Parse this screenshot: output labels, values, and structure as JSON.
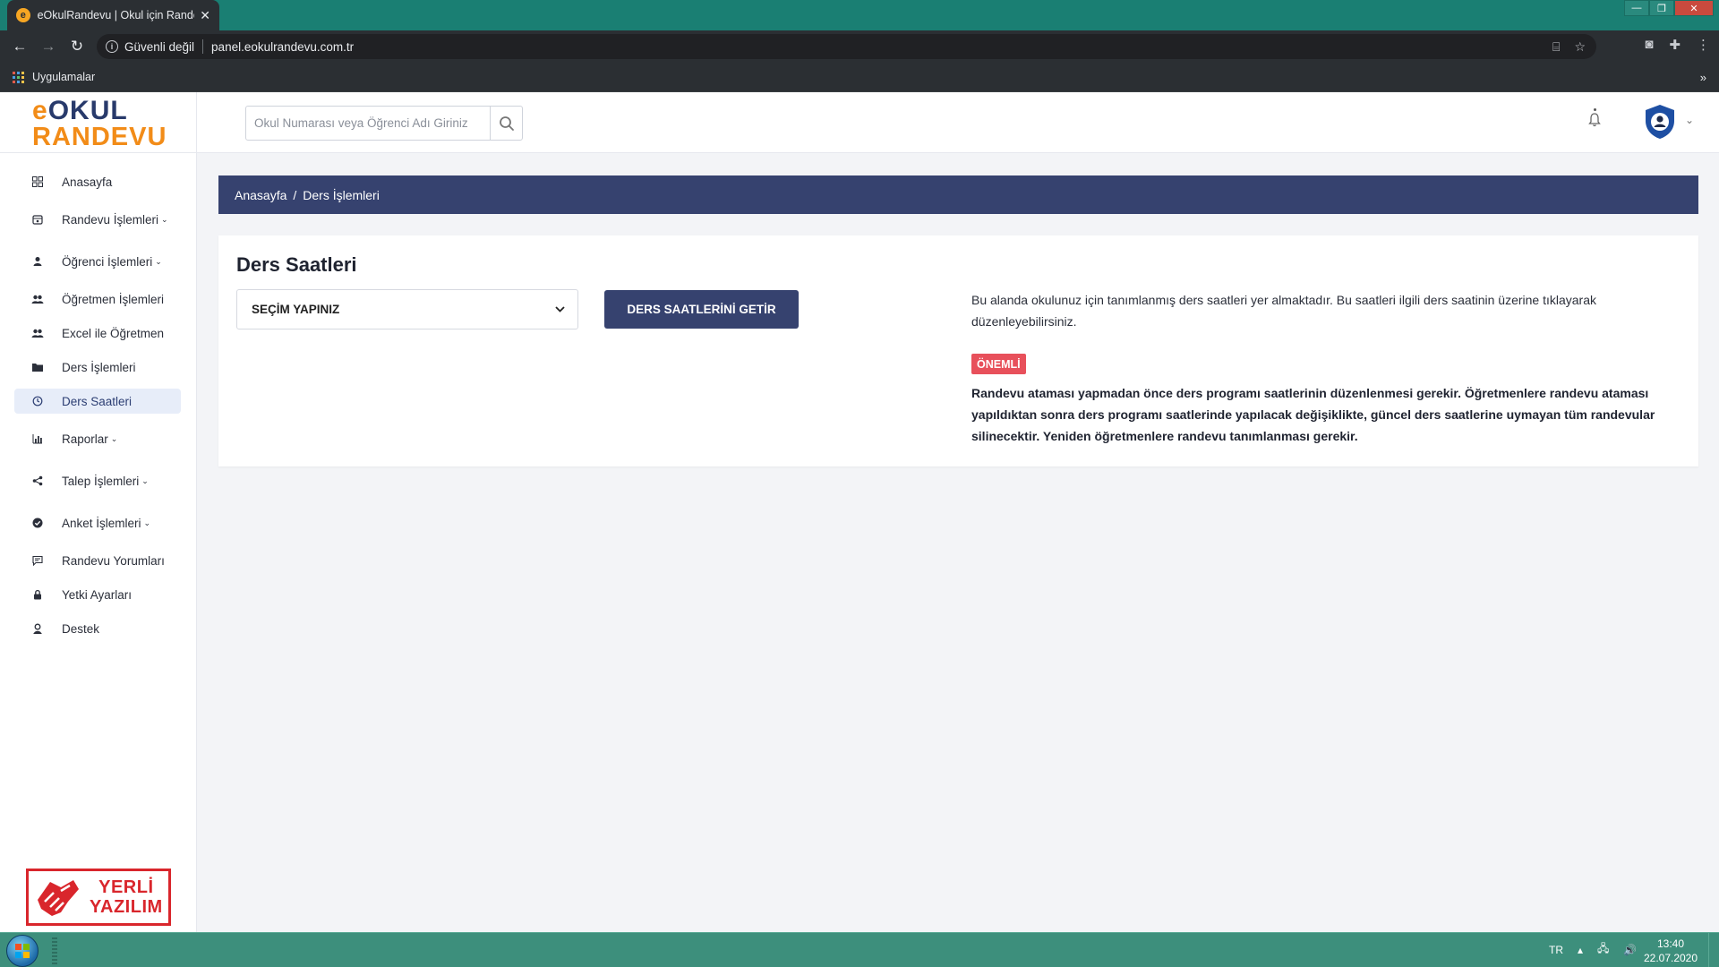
{
  "browser": {
    "tab_title": "eOkulRandevu | Okul için Randevu Sistemi",
    "tab_close": "✕",
    "security_label": "Güvenli değil",
    "url": "panel.eokulrandevu.com.tr",
    "bookmark_apps": "Uygulamalar",
    "bookmark_more": "»"
  },
  "header": {
    "logo_e": "e",
    "logo_okul": "OKUL",
    "logo_randevu": "RANDEVU",
    "search_placeholder": "Okul Numarası veya Öğrenci Adı Giriniz"
  },
  "sidebar": {
    "items": [
      {
        "label": "Anasayfa",
        "icon": "dashboard-icon"
      },
      {
        "label": "Randevu İşlemleri",
        "icon": "calendar-icon",
        "caret": true
      },
      {
        "label": "Öğrenci İşlemleri",
        "icon": "user-icon",
        "caret": true
      },
      {
        "label": "Öğretmen İşlemleri",
        "icon": "users-icon"
      },
      {
        "label": "Excel ile Öğretmen",
        "icon": "users-icon"
      },
      {
        "label": "Ders İşlemleri",
        "icon": "folder-icon"
      },
      {
        "label": "Ders Saatleri",
        "icon": "clock-icon",
        "active": true
      },
      {
        "label": "Raporlar",
        "icon": "bar-chart-icon",
        "caret": true
      },
      {
        "label": "Talep İşlemleri",
        "icon": "share-icon",
        "caret": true
      },
      {
        "label": "Anket İşlemleri",
        "icon": "check-circle-icon",
        "caret": true
      },
      {
        "label": "Randevu Yorumları",
        "icon": "comment-icon"
      },
      {
        "label": "Yetki Ayarları",
        "icon": "lock-icon"
      },
      {
        "label": "Destek",
        "icon": "support-icon"
      }
    ],
    "badge_line1": "YERLİ",
    "badge_line2": "YAZILIM"
  },
  "breadcrumb": {
    "home": "Anasayfa",
    "separator": "/",
    "current": "Ders İşlemleri"
  },
  "main": {
    "title": "Ders Saatleri",
    "select_value": "SEÇİM YAPINIZ",
    "button_label": "DERS SAATLERİNİ GETİR",
    "info_text": "Bu alanda okulunuz için tanımlanmış ders saatleri yer almaktadır. Bu saatleri ilgili ders saatinin üzerine tıklayarak düzenleyebilirsiniz.",
    "important_badge": "ÖNEMLİ",
    "warning_text": "Randevu ataması yapmadan önce ders programı saatlerinin düzenlenmesi gerekir. Öğretmenlere randevu ataması yapıldıktan sonra ders programı saatlerinde yapılacak değişiklikte, güncel ders saatlerine uymayan tüm randevular silinecektir. Yeniden öğretmenlere randevu tanımlanması gerekir."
  },
  "taskbar": {
    "language": "TR",
    "time": "13:40",
    "date": "22.07.2020"
  },
  "colors": {
    "accent": "#36426f",
    "logo_orange": "#f28c18",
    "logo_navy": "#283a6b",
    "important": "#e8505b",
    "active_bg": "#e7edf9"
  }
}
